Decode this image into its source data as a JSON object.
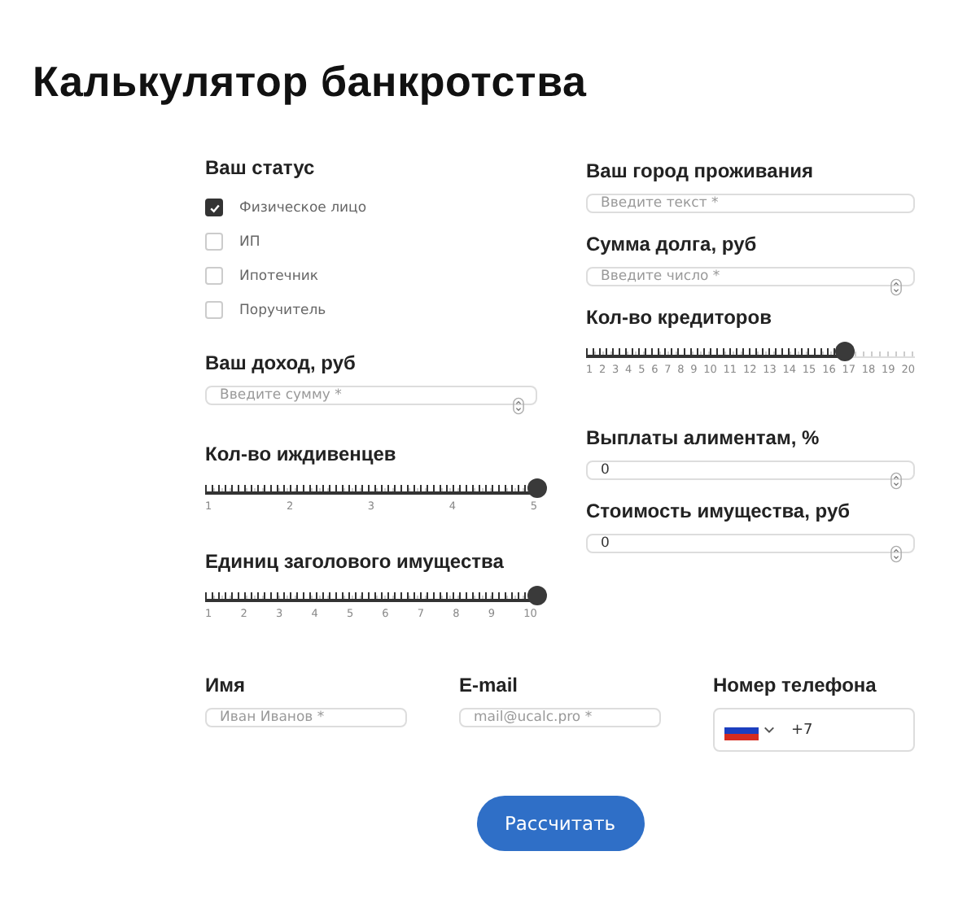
{
  "title": "Калькулятор банкротства",
  "left": [
    {
      "kind": "checks",
      "label": "Ваш статус",
      "options": [
        {
          "label": "Физическое лицо",
          "checked": true
        },
        {
          "label": "ИП",
          "checked": false
        },
        {
          "label": "Ипотечник",
          "checked": false
        },
        {
          "label": "Поручитель",
          "checked": false
        }
      ]
    },
    {
      "kind": "number",
      "label": "Ваш доход, руб",
      "placeholder": "Введите сумму *"
    },
    {
      "kind": "slider",
      "label": "Кол-во иждивенцев",
      "level": 1,
      "ticks": [
        "1",
        "2",
        "3",
        "4",
        "5"
      ]
    },
    {
      "kind": "slider",
      "label": "Единиц заголового имущества",
      "level": 1,
      "ticks": [
        "1",
        "2",
        "3",
        "4",
        "5",
        "6",
        "7",
        "8",
        "9",
        "10"
      ]
    }
  ],
  "right": [
    {
      "kind": "text",
      "label": "Ваш город проживания",
      "placeholder": "Введите текст *"
    },
    {
      "kind": "number",
      "label": "Сумма долга, руб",
      "placeholder": "Введите число *"
    },
    {
      "kind": "slider",
      "label": "Кол-во кредиторов",
      "level": 0.789,
      "ticks": [
        "1",
        "2",
        "3",
        "4",
        "5",
        "6",
        "7",
        "8",
        "9",
        "10",
        "11",
        "12",
        "13",
        "14",
        "15",
        "16",
        "17",
        "18",
        "19",
        "20"
      ]
    },
    {
      "kind": "number",
      "label": "Выплаты алиментам, %",
      "value": "0"
    },
    {
      "kind": "number",
      "label": "Стоимость имущества, руб",
      "value": "0"
    }
  ],
  "contacts": [
    {
      "kind": "text",
      "label": "Имя",
      "placeholder": "Иван Иванов *"
    },
    {
      "kind": "text",
      "label": "E-mail",
      "placeholder": "mail@ucalc.pro *"
    },
    {
      "kind": "phone",
      "label": "Номер телефона",
      "value": "+7"
    }
  ],
  "submit": "Рассчитать"
}
